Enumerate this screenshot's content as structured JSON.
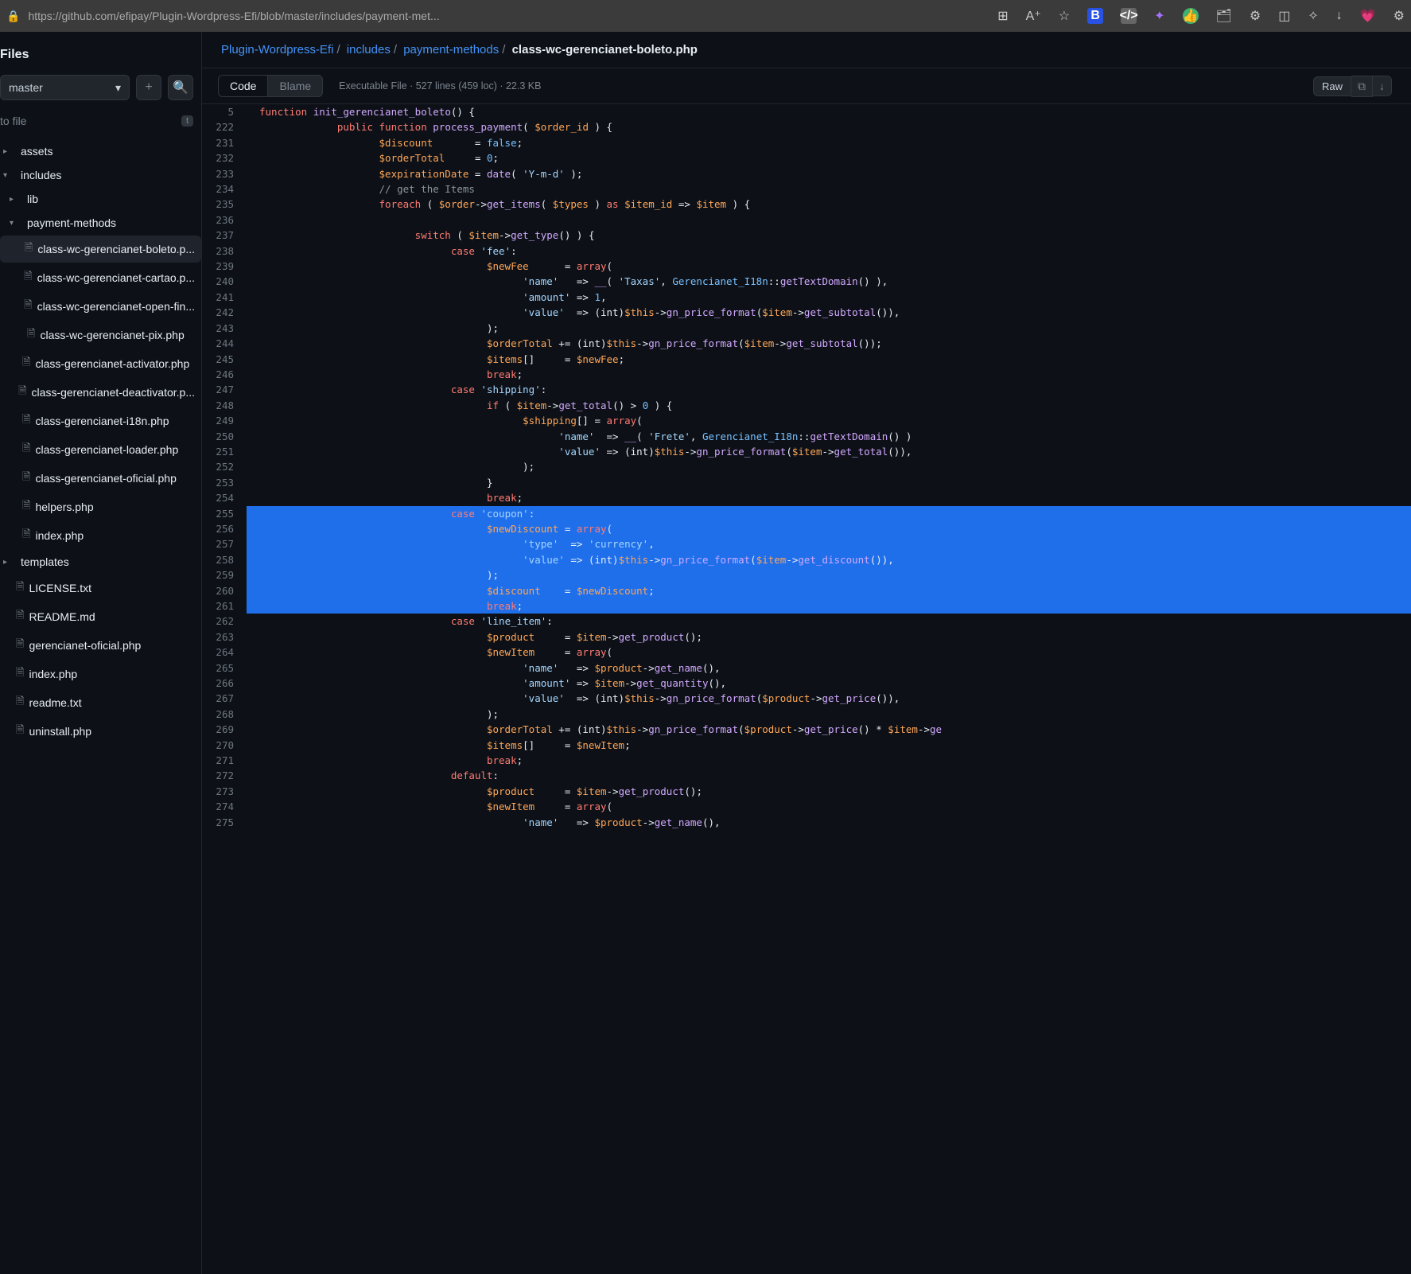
{
  "browser": {
    "url": "https://github.com/efipay/Plugin-Wordpress-Efi/blob/master/includes/payment-met..."
  },
  "sidebar": {
    "title": "Files",
    "branch": "master",
    "goto": "to file",
    "kbd": "t",
    "tree": [
      {
        "type": "dir",
        "label": "assets",
        "indent": 0
      },
      {
        "type": "dir",
        "label": "includes",
        "indent": 0,
        "open": true
      },
      {
        "type": "dir",
        "label": "lib",
        "indent": 1
      },
      {
        "type": "dir",
        "label": "payment-methods",
        "indent": 1,
        "open": true
      },
      {
        "type": "file",
        "label": "class-wc-gerencianet-boleto.p...",
        "indent": 2,
        "selected": true
      },
      {
        "type": "file",
        "label": "class-wc-gerencianet-cartao.p...",
        "indent": 2
      },
      {
        "type": "file",
        "label": "class-wc-gerencianet-open-fin...",
        "indent": 2
      },
      {
        "type": "file",
        "label": "class-wc-gerencianet-pix.php",
        "indent": 2
      },
      {
        "type": "file",
        "label": "class-gerencianet-activator.php",
        "indent": 1
      },
      {
        "type": "file",
        "label": "class-gerencianet-deactivator.p...",
        "indent": 1
      },
      {
        "type": "file",
        "label": "class-gerencianet-i18n.php",
        "indent": 1
      },
      {
        "type": "file",
        "label": "class-gerencianet-loader.php",
        "indent": 1
      },
      {
        "type": "file",
        "label": "class-gerencianet-oficial.php",
        "indent": 1
      },
      {
        "type": "file",
        "label": "helpers.php",
        "indent": 1
      },
      {
        "type": "file",
        "label": "index.php",
        "indent": 1
      },
      {
        "type": "dir",
        "label": "templates",
        "indent": 0
      },
      {
        "type": "file",
        "label": "LICENSE.txt",
        "indent": 0
      },
      {
        "type": "file",
        "label": "README.md",
        "indent": 0
      },
      {
        "type": "file",
        "label": "gerencianet-oficial.php",
        "indent": 0
      },
      {
        "type": "file",
        "label": "index.php",
        "indent": 0
      },
      {
        "type": "file",
        "label": "readme.txt",
        "indent": 0
      },
      {
        "type": "file",
        "label": "uninstall.php",
        "indent": 0
      }
    ]
  },
  "breadcrumbs": {
    "items": [
      "Plugin-Wordpress-Efi",
      "includes",
      "payment-methods"
    ],
    "current": "class-wc-gerencianet-boleto.php"
  },
  "tabs": {
    "code": "Code",
    "blame": "Blame"
  },
  "fileinfo": "Executable File  ·  527 lines (459 loc)  ·  22.3 KB",
  "raw": "Raw",
  "code": [
    {
      "n": "5",
      "sel": false,
      "html": "<span class='k-red'>function</span> <span class='k-purple'>init_gerencianet_boleto</span>() {"
    },
    {
      "n": "222",
      "sel": false,
      "html": "             <span class='k-red'>public</span> <span class='k-red'>function</span> <span class='k-purple'>process_payment</span>( <span class='k-orange'>$order_id</span> ) {"
    },
    {
      "n": "231",
      "sel": false,
      "html": "                    <span class='k-orange'>$discount</span>       = <span class='k-blue'>false</span>;"
    },
    {
      "n": "232",
      "sel": false,
      "html": "                    <span class='k-orange'>$orderTotal</span>     = <span class='k-blue'>0</span>;"
    },
    {
      "n": "233",
      "sel": false,
      "html": "                    <span class='k-orange'>$expirationDate</span> = <span class='k-purple'>date</span>( <span class='k-str'>'Y-m-d'</span> );"
    },
    {
      "n": "234",
      "sel": false,
      "html": "                    <span class='k-cmt'>// get the Items</span>"
    },
    {
      "n": "235",
      "sel": false,
      "html": "                    <span class='k-red'>foreach</span> ( <span class='k-orange'>$order</span>-><span class='k-purple'>get_items</span>( <span class='k-orange'>$types</span> ) <span class='k-red'>as</span> <span class='k-orange'>$item_id</span> => <span class='k-orange'>$item</span> ) {"
    },
    {
      "n": "236",
      "sel": false,
      "html": ""
    },
    {
      "n": "237",
      "sel": false,
      "html": "                          <span class='k-red'>switch</span> ( <span class='k-orange'>$item</span>-><span class='k-purple'>get_type</span>() ) {"
    },
    {
      "n": "238",
      "sel": false,
      "html": "                                <span class='k-red'>case</span> <span class='k-str'>'fee'</span>:"
    },
    {
      "n": "239",
      "sel": false,
      "html": "                                      <span class='k-orange'>$newFee</span>      = <span class='k-red'>array</span>("
    },
    {
      "n": "240",
      "sel": false,
      "html": "                                            <span class='k-str'>'name'</span>   => <span class='k-purple'>__</span>( <span class='k-str'>'Taxas'</span>, <span class='k-blue'>Gerencianet_I18n</span>::<span class='k-purple'>getTextDomain</span>() ),"
    },
    {
      "n": "241",
      "sel": false,
      "html": "                                            <span class='k-str'>'amount'</span> => <span class='k-blue'>1</span>,"
    },
    {
      "n": "242",
      "sel": false,
      "html": "                                            <span class='k-str'>'value'</span>  => (int)<span class='k-orange'>$this</span>-><span class='k-purple'>gn_price_format</span>(<span class='k-orange'>$item</span>-><span class='k-purple'>get_subtotal</span>()),"
    },
    {
      "n": "243",
      "sel": false,
      "html": "                                      );"
    },
    {
      "n": "244",
      "sel": false,
      "html": "                                      <span class='k-orange'>$orderTotal</span> += (int)<span class='k-orange'>$this</span>-><span class='k-purple'>gn_price_format</span>(<span class='k-orange'>$item</span>-><span class='k-purple'>get_subtotal</span>());"
    },
    {
      "n": "245",
      "sel": false,
      "html": "                                      <span class='k-orange'>$items</span>[]     = <span class='k-orange'>$newFee</span>;"
    },
    {
      "n": "246",
      "sel": false,
      "html": "                                      <span class='k-red'>break</span>;"
    },
    {
      "n": "247",
      "sel": false,
      "html": "                                <span class='k-red'>case</span> <span class='k-str'>'shipping'</span>:"
    },
    {
      "n": "248",
      "sel": false,
      "html": "                                      <span class='k-red'>if</span> ( <span class='k-orange'>$item</span>-><span class='k-purple'>get_total</span>() > <span class='k-blue'>0</span> ) {"
    },
    {
      "n": "249",
      "sel": false,
      "html": "                                            <span class='k-orange'>$shipping</span>[] = <span class='k-red'>array</span>("
    },
    {
      "n": "250",
      "sel": false,
      "html": "                                                  <span class='k-str'>'name'</span>  => <span class='k-purple'>__</span>( <span class='k-str'>'Frete'</span>, <span class='k-blue'>Gerencianet_I18n</span>::<span class='k-purple'>getTextDomain</span>() )"
    },
    {
      "n": "251",
      "sel": false,
      "html": "                                                  <span class='k-str'>'value'</span> => (int)<span class='k-orange'>$this</span>-><span class='k-purple'>gn_price_format</span>(<span class='k-orange'>$item</span>-><span class='k-purple'>get_total</span>()),"
    },
    {
      "n": "252",
      "sel": false,
      "html": "                                            );"
    },
    {
      "n": "253",
      "sel": false,
      "html": "                                      }"
    },
    {
      "n": "254",
      "sel": false,
      "html": "                                      <span class='k-red'>break</span>;"
    },
    {
      "n": "255",
      "sel": true,
      "html": "                                <span style='background:#1f6feb'><span class='k-red'>case</span> <span class='k-str'>'coupon'</span>:</span>"
    },
    {
      "n": "256",
      "sel": true,
      "html": "                                      <span class='k-orange'>$newDiscount</span> = <span class='k-red'>array</span>("
    },
    {
      "n": "257",
      "sel": true,
      "html": "                                            <span class='k-str'>'type'</span>  => <span class='k-str'>'currency'</span>,"
    },
    {
      "n": "258",
      "sel": true,
      "html": "                                            <span class='k-str'>'value'</span> => (int)<span class='k-orange'>$this</span>-><span class='k-purple'>gn_price_format</span>(<span class='k-orange'>$item</span>-><span class='k-purple'>get_discount</span>()),"
    },
    {
      "n": "259",
      "sel": true,
      "html": "                                      );"
    },
    {
      "n": "260",
      "sel": true,
      "html": "                                      <span class='k-orange'>$discount</span>    = <span class='k-orange'>$newDiscount</span>;"
    },
    {
      "n": "261",
      "sel": true,
      "html": "                                      <span class='k-red'>break</span>;"
    },
    {
      "n": "262",
      "sel": false,
      "html": "                                <span class='k-red'>case</span> <span class='k-str'>'line_item'</span>:"
    },
    {
      "n": "263",
      "sel": false,
      "html": "                                      <span class='k-orange'>$product</span>     = <span class='k-orange'>$item</span>-><span class='k-purple'>get_product</span>();"
    },
    {
      "n": "264",
      "sel": false,
      "html": "                                      <span class='k-orange'>$newItem</span>     = <span class='k-red'>array</span>("
    },
    {
      "n": "265",
      "sel": false,
      "html": "                                            <span class='k-str'>'name'</span>   => <span class='k-orange'>$product</span>-><span class='k-purple'>get_name</span>(),"
    },
    {
      "n": "266",
      "sel": false,
      "html": "                                            <span class='k-str'>'amount'</span> => <span class='k-orange'>$item</span>-><span class='k-purple'>get_quantity</span>(),"
    },
    {
      "n": "267",
      "sel": false,
      "html": "                                            <span class='k-str'>'value'</span>  => (int)<span class='k-orange'>$this</span>-><span class='k-purple'>gn_price_format</span>(<span class='k-orange'>$product</span>-><span class='k-purple'>get_price</span>()),"
    },
    {
      "n": "268",
      "sel": false,
      "html": "                                      );"
    },
    {
      "n": "269",
      "sel": false,
      "html": "                                      <span class='k-orange'>$orderTotal</span> += (int)<span class='k-orange'>$this</span>-><span class='k-purple'>gn_price_format</span>(<span class='k-orange'>$product</span>-><span class='k-purple'>get_price</span>() * <span class='k-orange'>$item</span>-><span class='k-purple'>ge</span>"
    },
    {
      "n": "270",
      "sel": false,
      "html": "                                      <span class='k-orange'>$items</span>[]     = <span class='k-orange'>$newItem</span>;"
    },
    {
      "n": "271",
      "sel": false,
      "html": "                                      <span class='k-red'>break</span>;"
    },
    {
      "n": "272",
      "sel": false,
      "html": "                                <span class='k-red'>default</span>:"
    },
    {
      "n": "273",
      "sel": false,
      "html": "                                      <span class='k-orange'>$product</span>     = <span class='k-orange'>$item</span>-><span class='k-purple'>get_product</span>();"
    },
    {
      "n": "274",
      "sel": false,
      "html": "                                      <span class='k-orange'>$newItem</span>     = <span class='k-red'>array</span>("
    },
    {
      "n": "275",
      "sel": false,
      "html": "                                            <span class='k-str'>'name'</span>   => <span class='k-orange'>$product</span>-><span class='k-purple'>get_name</span>(),"
    }
  ]
}
